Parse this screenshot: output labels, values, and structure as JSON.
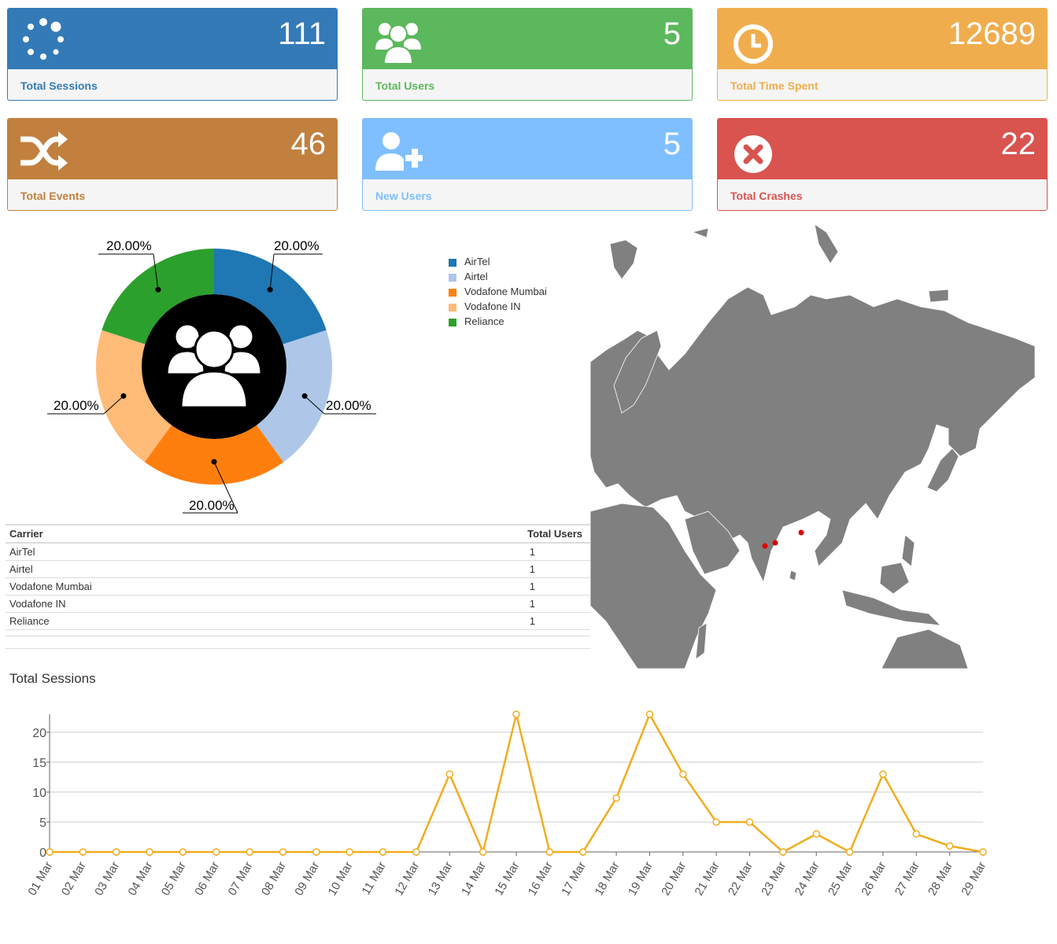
{
  "cards": [
    {
      "value": "111",
      "label": "Total Sessions",
      "icon": "spinner-icon"
    },
    {
      "value": "5",
      "label": "Total Users",
      "icon": "users-icon"
    },
    {
      "value": "12689",
      "label": "Total Time Spent",
      "icon": "clock-icon"
    },
    {
      "value": "46",
      "label": "Total Events",
      "icon": "shuffle-icon"
    },
    {
      "value": "5",
      "label": "New Users",
      "icon": "user-plus-icon"
    },
    {
      "value": "22",
      "label": "Total Crashes",
      "icon": "times-circle-icon"
    }
  ],
  "colors": {
    "primary": "#337ab7",
    "success": "#5cb85c",
    "warning": "#f0ad4e",
    "brown": "#c1803e",
    "light_blue": "#7fbfff",
    "danger": "#d9534f",
    "map_land": "#808080",
    "map_marker": "#e00000",
    "line": "#f0ad1e"
  },
  "pie": {
    "chart_data": {
      "type": "pie",
      "categories": [
        "AirTel",
        "Airtel",
        "Vodafone Mumbai",
        "Vodafone IN",
        "Reliance"
      ],
      "values": [
        20.0,
        20.0,
        20.0,
        20.0,
        20.0
      ],
      "labels": [
        "20.00%",
        "20.00%",
        "20.00%",
        "20.00%",
        "20.00%"
      ],
      "colors": [
        "#1f77b4",
        "#aec7e8",
        "#ff7f0e",
        "#ffbb78",
        "#2ca02c"
      ],
      "legend": "right"
    }
  },
  "table": {
    "headers": [
      "Carrier",
      "Total Users"
    ],
    "rows": [
      [
        "AirTel",
        "1"
      ],
      [
        "Airtel",
        "1"
      ],
      [
        "Vodafone Mumbai",
        "1"
      ],
      [
        "Vodafone IN",
        "1"
      ],
      [
        "Reliance",
        "1"
      ]
    ]
  },
  "line_chart": {
    "title": "Total Sessions",
    "chart_data": {
      "type": "line",
      "x": [
        "01 Mar",
        "02 Mar",
        "03 Mar",
        "04 Mar",
        "05 Mar",
        "06 Mar",
        "07 Mar",
        "08 Mar",
        "09 Mar",
        "10 Mar",
        "11 Mar",
        "12 Mar",
        "13 Mar",
        "14 Mar",
        "15 Mar",
        "16 Mar",
        "17 Mar",
        "18 Mar",
        "19 Mar",
        "20 Mar",
        "21 Mar",
        "22 Mar",
        "23 Mar",
        "24 Mar",
        "25 Mar",
        "26 Mar",
        "27 Mar",
        "28 Mar",
        "29 Mar"
      ],
      "values": [
        0,
        0,
        0,
        0,
        0,
        0,
        0,
        0,
        0,
        0,
        0,
        0,
        13,
        0,
        23,
        0,
        0,
        9,
        23,
        13,
        5,
        5,
        0,
        3,
        0,
        13,
        3,
        1,
        0
      ],
      "yticks": [
        0,
        5,
        10,
        15,
        20
      ],
      "ylim": [
        0,
        23
      ],
      "grid": true
    }
  },
  "map": {
    "markers_region": "India"
  }
}
